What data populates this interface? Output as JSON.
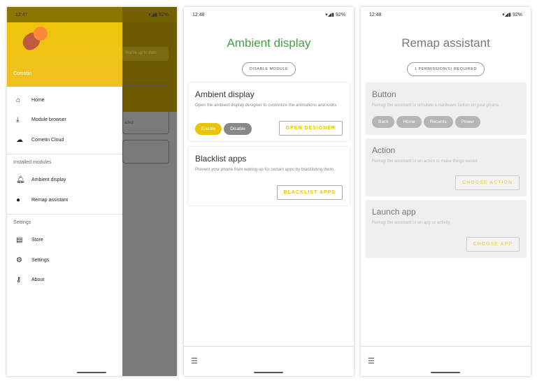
{
  "colors": {
    "accent": "#eac40a",
    "active_title": "#43a047"
  },
  "status": [
    {
      "time": "12:47",
      "battery": "92%"
    },
    {
      "time": "12:48",
      "battery": "92%"
    },
    {
      "time": "12:48",
      "battery": "92%"
    }
  ],
  "drawer": {
    "app_name": "Cometin",
    "background_status": "You're up to date",
    "background_label": "alled",
    "main_items": [
      {
        "label": "Home",
        "icon": "home-icon"
      },
      {
        "label": "Module browser",
        "icon": "download-icon"
      },
      {
        "label": "Cometin Cloud",
        "icon": "cloud-off-icon"
      }
    ],
    "installed_header": "Installed modules",
    "installed_items": [
      {
        "label": "Ambient display",
        "icon": "bell-icon"
      },
      {
        "label": "Remap assistant",
        "icon": "assistant-icon"
      }
    ],
    "settings_header": "Settings",
    "settings_items": [
      {
        "label": "Store",
        "icon": "store-icon"
      },
      {
        "label": "Settings",
        "icon": "gear-icon"
      },
      {
        "label": "About",
        "icon": "key-icon"
      }
    ]
  },
  "ambient": {
    "title": "Ambient display",
    "module_button": "DISABLE MODULE",
    "card1": {
      "title": "Ambient display",
      "desc": "Open the ambient display designer to customize the animations and looks",
      "enable": "Enable",
      "disable": "Disable",
      "action": "OPEN DESIGNER"
    },
    "card2": {
      "title": "Blacklist apps",
      "desc": "Prevent your phone from waking up for certain apps by blacklisting them.",
      "action": "BLACKLIST APPS"
    }
  },
  "remap": {
    "title": "Remap assistant",
    "permission_button": "1 PERMISSION(S) REQUIRED",
    "card1": {
      "title": "Button",
      "desc": "Remap the assistant to simulate a hardware button on your phone.",
      "chips": [
        "Back",
        "Home",
        "Recents",
        "Power"
      ]
    },
    "card2": {
      "title": "Action",
      "desc": "Remap the assistant to an action to make things easier.",
      "action": "CHOOSE ACTION"
    },
    "card3": {
      "title": "Launch app",
      "desc": "Remap the assistant to an app or activity.",
      "action": "CHOOSE APP"
    }
  }
}
